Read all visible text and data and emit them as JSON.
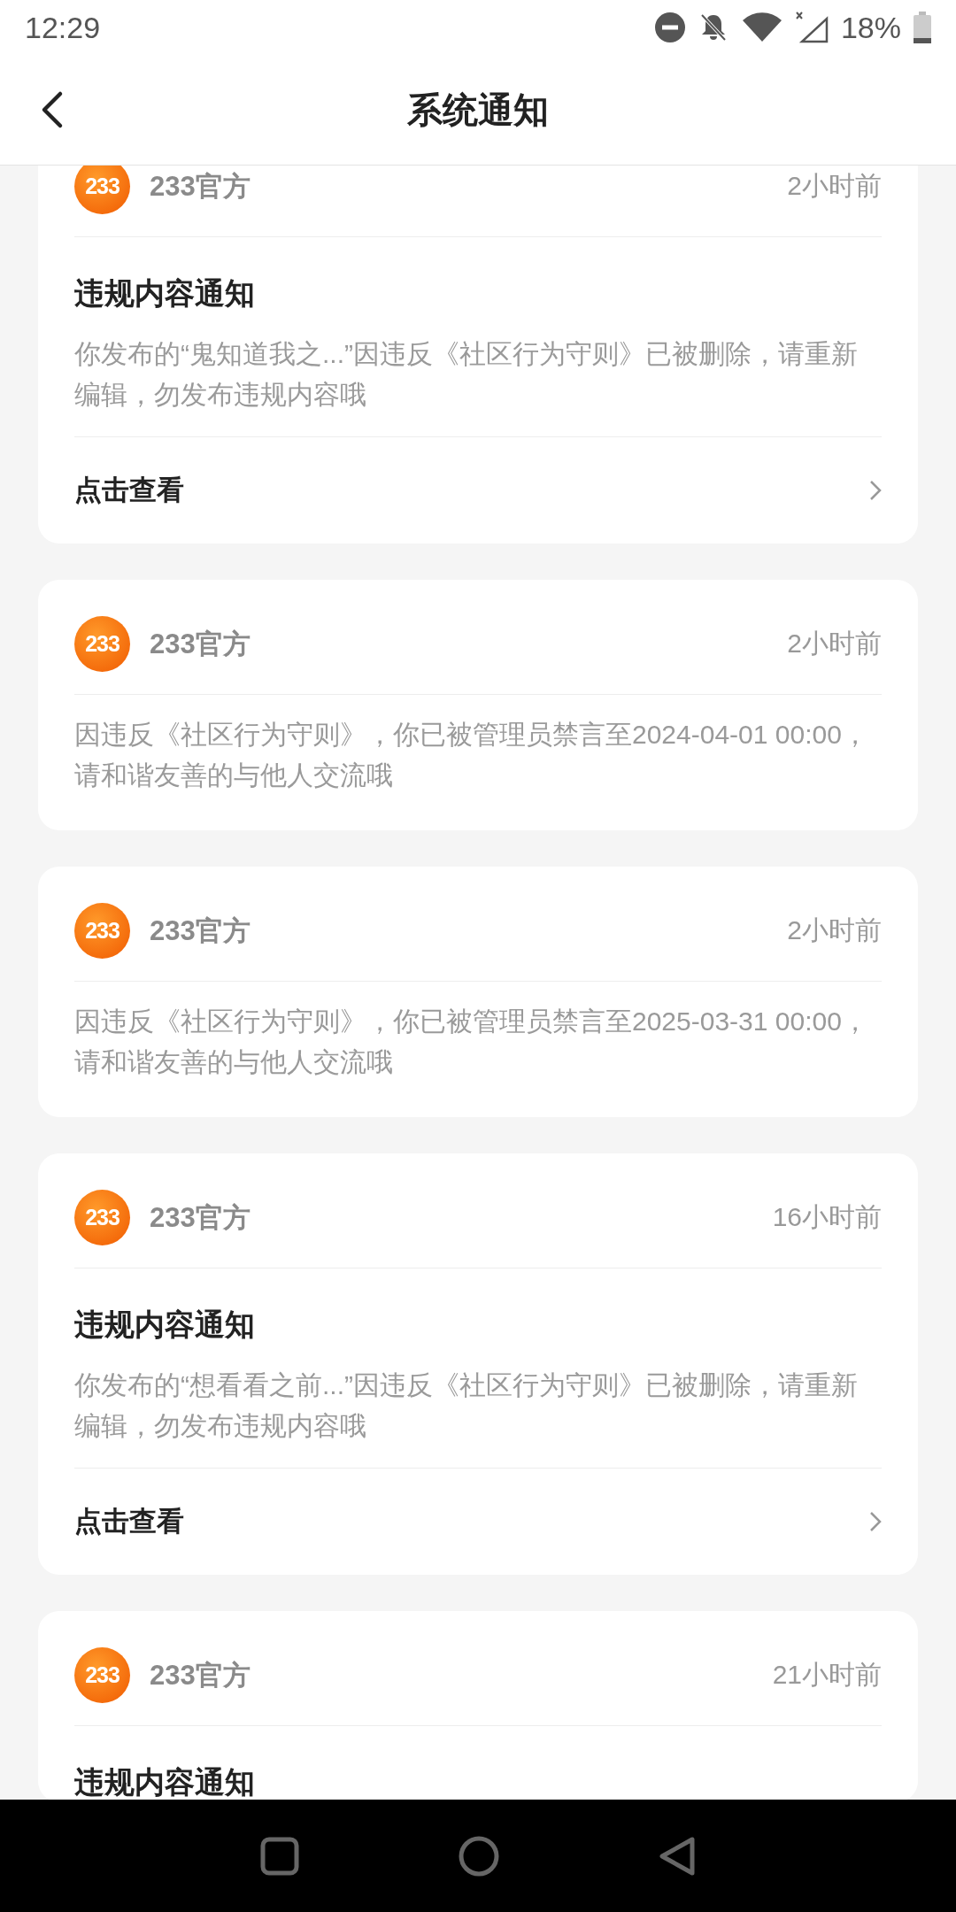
{
  "status_bar": {
    "time": "12:29",
    "battery": "18%"
  },
  "header": {
    "title": "系统通知"
  },
  "notifications": [
    {
      "logo": "233",
      "sender": "233官方",
      "time": "2小时前",
      "title": "违规内容通知",
      "body": "你发布的“鬼知道我之...”因违反《社区行为守则》已被删除，请重新编辑，勿发布违规内容哦",
      "link": "点击查看"
    },
    {
      "logo": "233",
      "sender": "233官方",
      "time": "2小时前",
      "body": "因违反《社区行为守则》，你已被管理员禁言至2024-04-01 00:00，请和谐友善的与他人交流哦"
    },
    {
      "logo": "233",
      "sender": "233官方",
      "time": "2小时前",
      "body": "因违反《社区行为守则》，你已被管理员禁言至2025-03-31 00:00，请和谐友善的与他人交流哦"
    },
    {
      "logo": "233",
      "sender": "233官方",
      "time": "16小时前",
      "title": "违规内容通知",
      "body": "你发布的“想看看之前...”因违反《社区行为守则》已被删除，请重新编辑，勿发布违规内容哦",
      "link": "点击查看"
    },
    {
      "logo": "233",
      "sender": "233官方",
      "time": "21小时前",
      "title": "违规内容通知"
    }
  ]
}
